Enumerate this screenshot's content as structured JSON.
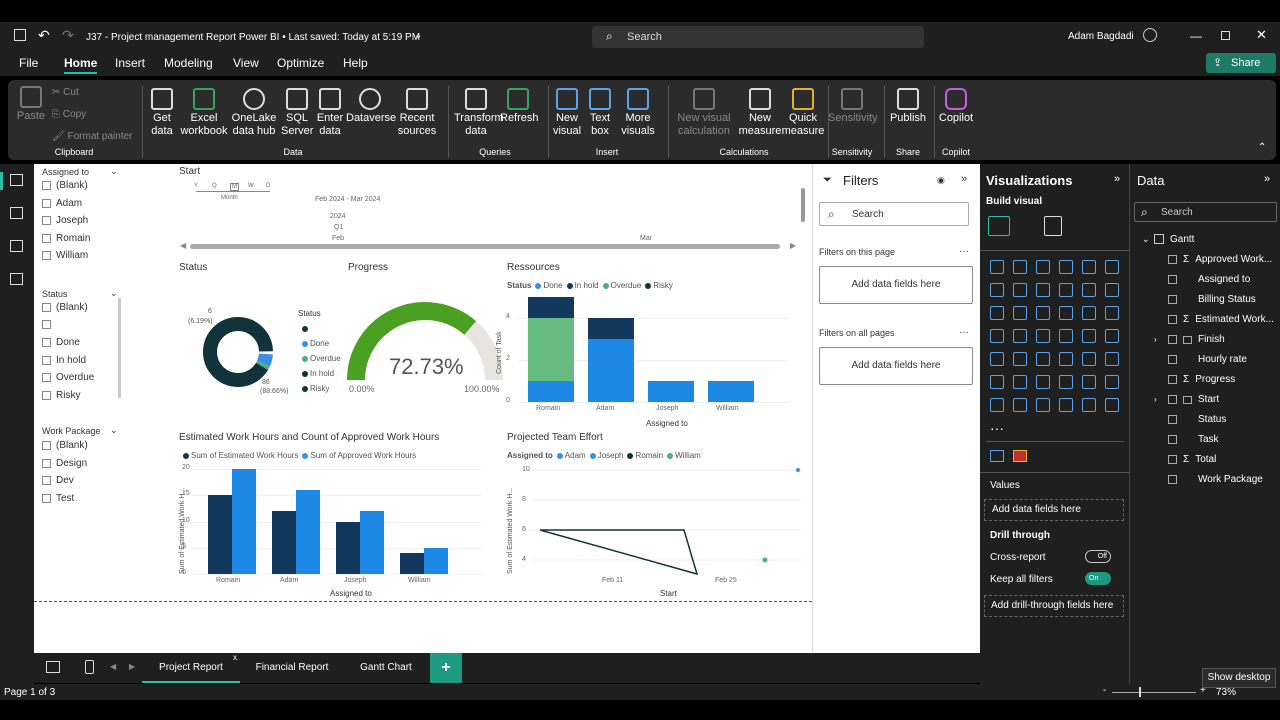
{
  "title_bar": {
    "doc_title": "J37 - Project management Report Power BI  •  Last saved: Today at 5:19 PM",
    "search_placeholder": "Search",
    "user_name": "Adam Bagdadi"
  },
  "menu": {
    "items": [
      "File",
      "Home",
      "Insert",
      "Modeling",
      "View",
      "Optimize",
      "Help"
    ],
    "share": "Share"
  },
  "ribbon": {
    "clipboard": {
      "paste": "Paste",
      "cut": "Cut",
      "copy": "Copy",
      "format_painter": "Format painter",
      "group": "Clipboard"
    },
    "data": {
      "get_data": "Get data",
      "excel": "Excel workbook",
      "onelake": "OneLake data hub",
      "sql": "SQL Server",
      "enter": "Enter data",
      "dataverse": "Dataverse",
      "recent": "Recent sources",
      "group": "Data"
    },
    "queries": {
      "transform": "Transform data",
      "refresh": "Refresh",
      "group": "Queries"
    },
    "insert": {
      "new_visual": "New visual",
      "text_box": "Text box",
      "more_visuals": "More visuals",
      "group": "Insert"
    },
    "calculations": {
      "new_visual_calc": "New visual calculation",
      "new_measure": "New measure",
      "quick_measure": "Quick measure",
      "group": "Calculations"
    },
    "sensitivity": {
      "label": "Sensitivity",
      "group": "Sensitivity"
    },
    "share": {
      "publish": "Publish",
      "group": "Share"
    },
    "copilot": {
      "label": "Copilot",
      "group": "Copilot"
    }
  },
  "slicers": {
    "assigned": {
      "title": "Assigned to",
      "items": [
        "(Blank)",
        "Adam",
        "Joseph",
        "Romain",
        "William"
      ]
    },
    "status": {
      "title": "Status",
      "items": [
        "(Blank)",
        "",
        "Done",
        "In hold",
        "Overdue",
        "Risky"
      ]
    },
    "work_package": {
      "title": "Work Package",
      "items": [
        "(Blank)",
        "Design",
        "Dev",
        "Test"
      ]
    }
  },
  "timeline": {
    "title": "Start",
    "granularity": [
      "Y",
      "Q",
      "M",
      "W",
      "D"
    ],
    "selected_granularity": "Month",
    "range": "Feb 2024 - Mar 2024",
    "year": "2024",
    "quarter": "Q1",
    "months": [
      "Feb",
      "Mar"
    ]
  },
  "status_donut": {
    "title": "Status",
    "legend_title": "Status",
    "legend": [
      "",
      "Done",
      "Overdue",
      "In hold",
      "Risky"
    ],
    "label_small": "6",
    "label_small_pct": "(6.19%)",
    "label_large": "86",
    "label_large_pct": "(88.66%)"
  },
  "progress_gauge": {
    "title": "Progress",
    "value": "72.73%",
    "min": "0.00%",
    "max": "100.00%",
    "fraction": 0.7273
  },
  "resources": {
    "title": "Ressources",
    "legend_title": "Status",
    "legend": [
      "Done",
      "In hold",
      "Overdue",
      "Risky"
    ],
    "ylabel": "Count of Task",
    "xlabel": "Assigned to",
    "y_ticks": [
      "4",
      "2",
      "0"
    ]
  },
  "hours_chart": {
    "title": "Estimated Work Hours and Count of Approved Work Hours",
    "legend": [
      "Sum of Estimated Work Hours",
      "Sum of Approved Work Hours"
    ],
    "ylabel": "Sum of Estimated Work H...",
    "xlabel": "Assigned to",
    "y_ticks": [
      "20",
      "15",
      "10",
      "5",
      "0"
    ]
  },
  "effort_chart": {
    "title": "Projected Team Effort",
    "legend_title": "Assigned to",
    "legend": [
      "Adam",
      "Joseph",
      "Romain",
      "William"
    ],
    "ylabel": "Sum of Estimated Work H...",
    "xlabel": "Start",
    "y_ticks": [
      "10",
      "8",
      "6",
      "4"
    ],
    "x_ticks": [
      "Feb 11",
      "Feb 25"
    ]
  },
  "chart_data": [
    {
      "type": "pie",
      "title": "Status",
      "categories": [
        "(Blank)",
        "Done",
        "Overdue",
        "In hold",
        "Risky"
      ],
      "values": [
        86,
        6,
        2,
        2,
        1
      ]
    },
    {
      "type": "bar",
      "title": "Ressources",
      "categories": [
        "Romain",
        "Adam",
        "Joseph",
        "William"
      ],
      "series": [
        {
          "name": "Done",
          "values": [
            1,
            3,
            1,
            1
          ]
        },
        {
          "name": "Overdue",
          "values": [
            3,
            0,
            0,
            0
          ]
        },
        {
          "name": "In hold",
          "values": [
            1,
            1,
            0,
            0
          ]
        }
      ],
      "ylabel": "Count of Task",
      "xlabel": "Assigned to",
      "ylim": [
        0,
        5
      ]
    },
    {
      "type": "bar",
      "title": "Estimated Work Hours and Count of Approved Work Hours",
      "categories": [
        "Romain",
        "Adam",
        "Joseph",
        "William"
      ],
      "series": [
        {
          "name": "Sum of Estimated Work Hours",
          "values": [
            15,
            12,
            10,
            4
          ]
        },
        {
          "name": "Sum of Approved Work Hours",
          "values": [
            20,
            16,
            12,
            5
          ]
        }
      ],
      "ylabel": "Sum of Estimated Work H...",
      "xlabel": "Assigned to",
      "ylim": [
        0,
        20
      ]
    },
    {
      "type": "line",
      "title": "Projected Team Effort",
      "x": [
        "Feb 11",
        "Feb 25"
      ],
      "ylim": [
        3,
        10
      ]
    }
  ],
  "filters": {
    "title": "Filters",
    "search": "Search",
    "on_page": "Filters on this page",
    "on_all": "Filters on all pages",
    "add": "Add data fields here"
  },
  "visualizations": {
    "title": "Visualizations",
    "build": "Build visual",
    "values": "Values",
    "add": "Add data fields here",
    "drill": "Drill through",
    "cross": "Cross-report",
    "cross_state": "Off",
    "keep": "Keep all filters",
    "keep_state": "On",
    "add_drill": "Add drill-through fields here"
  },
  "data_pane": {
    "title": "Data",
    "search": "Search",
    "table": "Gantt",
    "fields": [
      "Approved Work...",
      "Assigned to",
      "Billing Status",
      "Estimated Work...",
      "Finish",
      "Hourly rate",
      "Progress",
      "Start",
      "Status",
      "Task",
      "Total",
      "Work Package"
    ]
  },
  "tabs": {
    "pages": [
      "Project Report",
      "Financial Report",
      "Gantt Chart"
    ],
    "add": "+"
  },
  "status_bar": {
    "page": "Page 1 of 3",
    "zoom": "73%",
    "tooltip": "Show desktop"
  }
}
